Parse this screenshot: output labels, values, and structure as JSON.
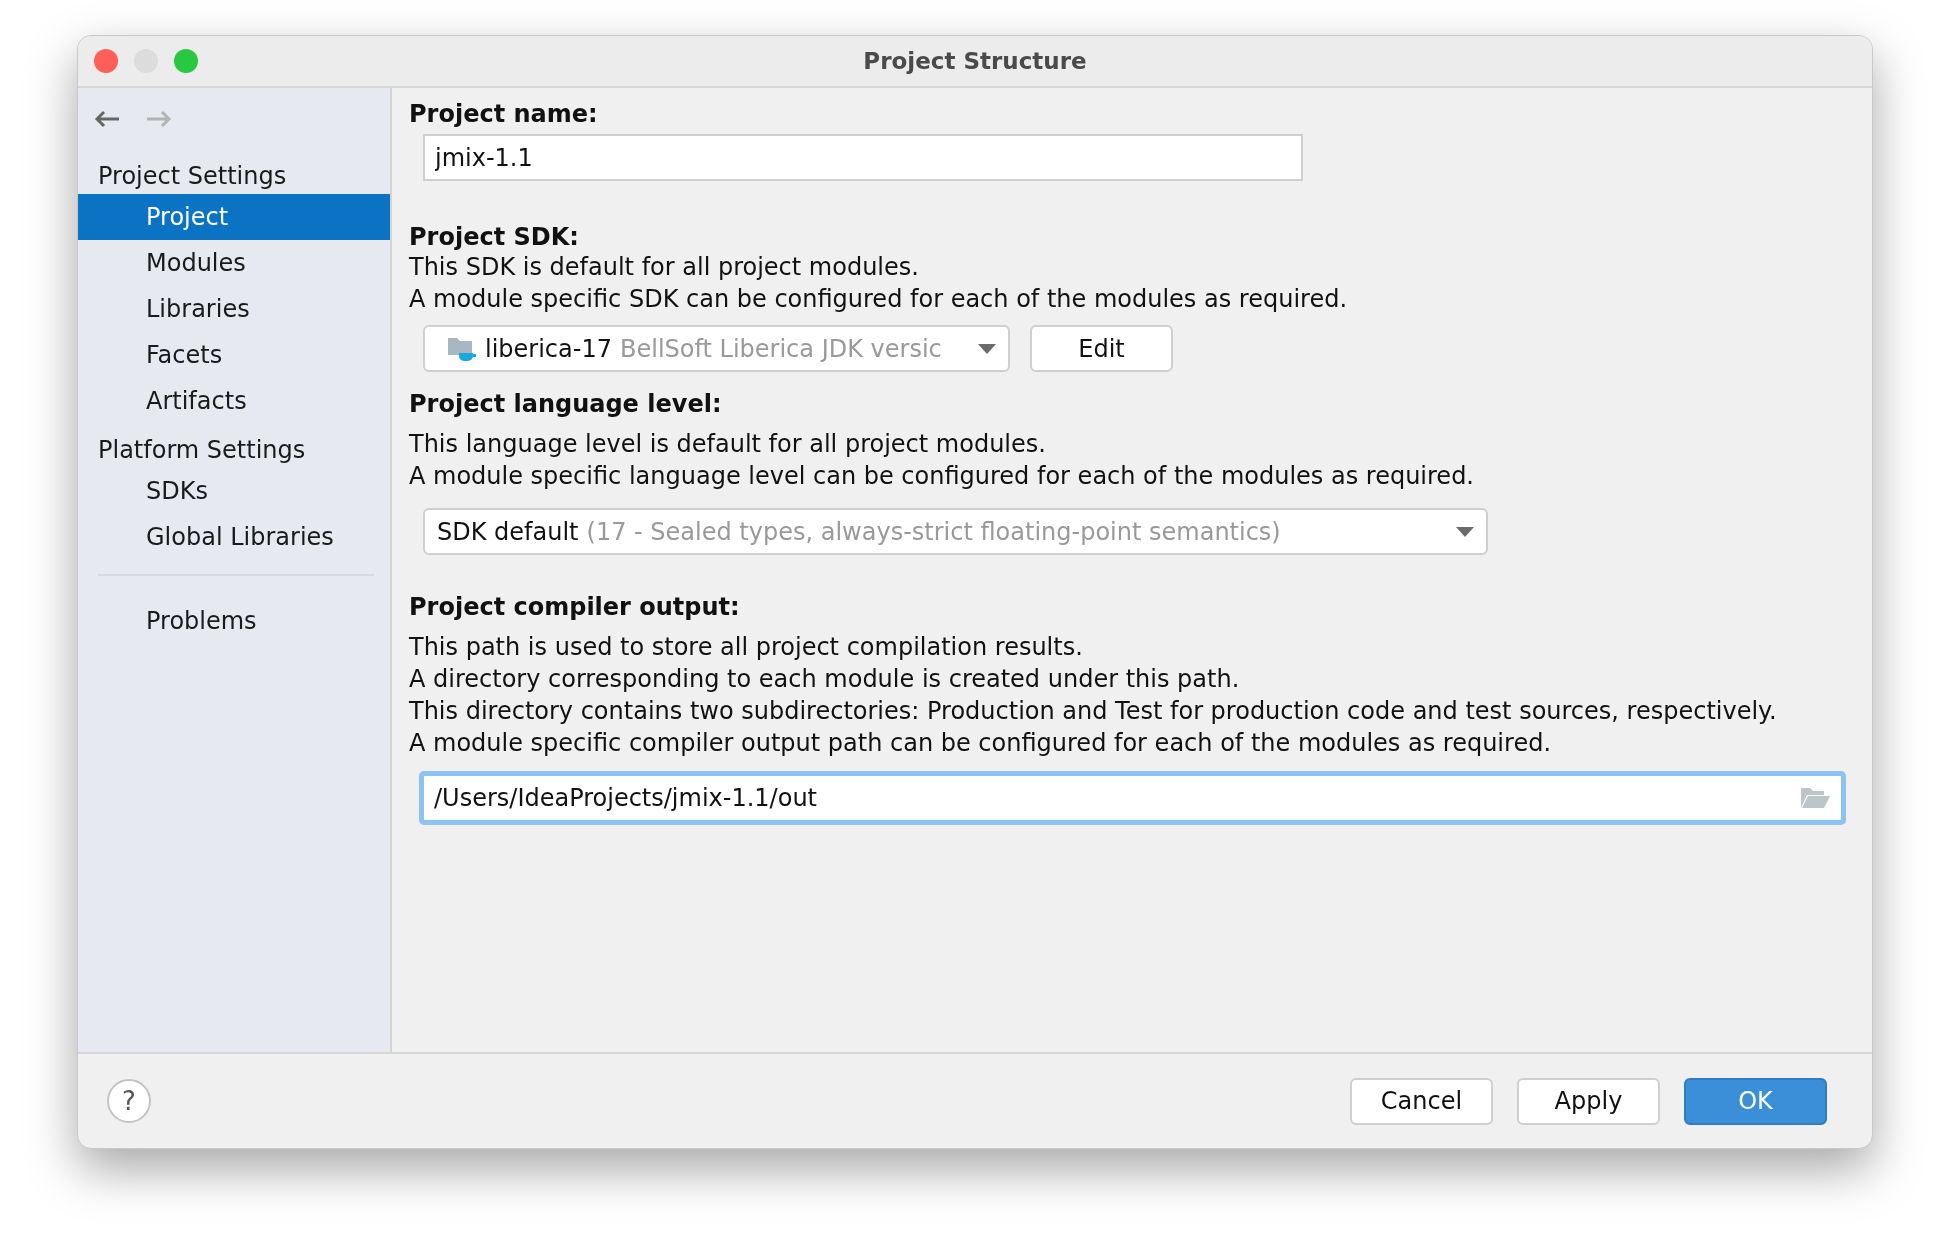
{
  "window": {
    "title": "Project Structure"
  },
  "nav": [
    {
      "kind": "back",
      "disabled": false
    },
    {
      "kind": "forward",
      "disabled": true
    }
  ],
  "sidebar": {
    "sections": [
      {
        "label": "Project Settings",
        "items": [
          {
            "label": "Project",
            "selected": true
          },
          {
            "label": "Modules",
            "selected": false
          },
          {
            "label": "Libraries",
            "selected": false
          },
          {
            "label": "Facets",
            "selected": false
          },
          {
            "label": "Artifacts",
            "selected": false
          }
        ]
      },
      {
        "label": "Platform Settings",
        "items": [
          {
            "label": "SDKs",
            "selected": false
          },
          {
            "label": "Global Libraries",
            "selected": false
          }
        ]
      }
    ],
    "bottom_items": [
      {
        "label": "Problems",
        "selected": false
      }
    ]
  },
  "project_name": {
    "label": "Project name:",
    "value": "jmix-1.1"
  },
  "project_sdk": {
    "label": "Project SDK:",
    "description": [
      "This SDK is default for all project modules.",
      "A module specific SDK can be configured for each of the modules as required."
    ],
    "combo": {
      "value": "liberica-17",
      "detail": "BellSoft Liberica JDK versic"
    },
    "edit_button": "Edit"
  },
  "language_level": {
    "label": "Project language level:",
    "description": [
      "This language level is default for all project modules.",
      "A module specific language level can be configured for each of the modules as required."
    ],
    "combo": {
      "value": "SDK default",
      "detail": "(17 - Sealed types, always-strict floating-point semantics)"
    }
  },
  "compiler_output": {
    "label": "Project compiler output:",
    "description": [
      "This path is used to store all project compilation results.",
      "A directory corresponding to each module is created under this path.",
      "This directory contains two subdirectories: Production and Test for production code and test sources, respectively.",
      "A module specific compiler output path can be configured for each of the modules as required."
    ],
    "value": "/Users/IdeaProjects/jmix-1.1/out",
    "focused": true
  },
  "footer": {
    "help": "?",
    "buttons": [
      {
        "label": "Cancel",
        "kind": "default"
      },
      {
        "label": "Apply",
        "kind": "default"
      },
      {
        "label": "OK",
        "kind": "primary"
      }
    ]
  }
}
